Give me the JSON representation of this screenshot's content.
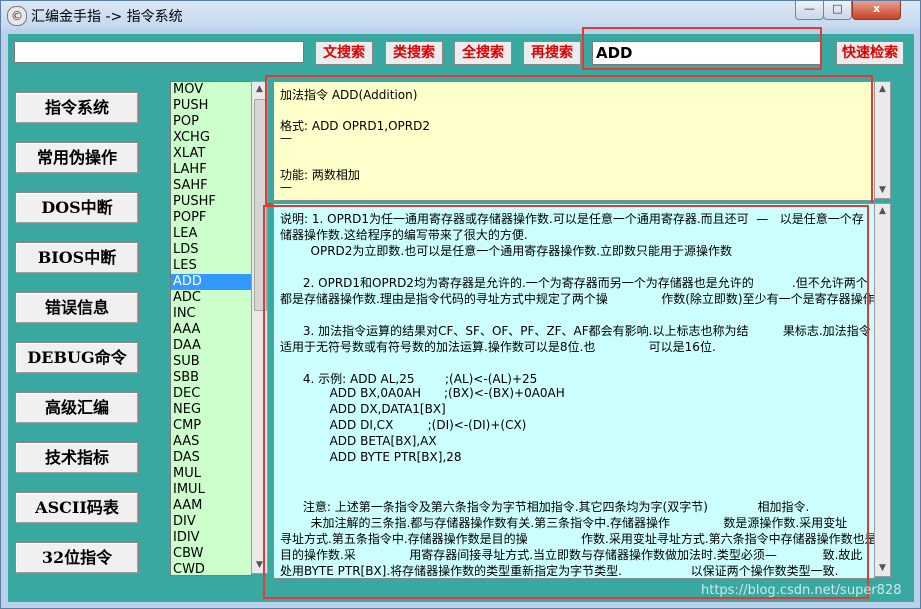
{
  "window": {
    "title": "汇编金手指 -> 指令系统",
    "icon": "app-logo-icon",
    "minimize_label": "—",
    "maximize_label": "□",
    "close_label": "x"
  },
  "toolbar": {
    "search_value": "",
    "buttons": [
      "文搜索",
      "类搜索",
      "全搜索",
      "再搜索"
    ],
    "command_value": "ADD",
    "quick_search_label": "快速检索"
  },
  "nav": {
    "items": [
      "指令系统",
      "常用伪操作",
      "DOS中断",
      "BIOS中断",
      "错误信息",
      "DEBUG命令",
      "高级汇编",
      "技术指标",
      "ASCII码表",
      "32位指令"
    ]
  },
  "instruction_list": {
    "items": [
      "MOV",
      "PUSH",
      "POP",
      "XCHG",
      "XLAT",
      "LAHF",
      "SAHF",
      "PUSHF",
      "POPF",
      "LEA",
      "LDS",
      "LES",
      "ADD",
      "ADC",
      "INC",
      "AAA",
      "DAA",
      "SUB",
      "SBB",
      "DEC",
      "NEG",
      "CMP",
      "AAS",
      "DAS",
      "MUL",
      "IMUL",
      "AAM",
      "DIV",
      "IDIV",
      "CBW",
      "CWD"
    ],
    "selected": "ADD"
  },
  "definition": {
    "title": "加法指令 ADD(Addition)",
    "format_line": "格式: ADD OPRD1,OPRD2",
    "format_underline": "—",
    "function_line": "功能: 两数相加",
    "function_underline": "—"
  },
  "description": {
    "lines": [
      "说明: 1. OPRD1为任一通用寄存器或存储器操作数.可以是任意一个通用寄存器.而且还可  —   以是任意一个存",
      "储器操作数.这给程序的编写带来了很大的方便.",
      "        OPRD2为立即数.也可以是任意一个通用寄存器操作数.立即数只能用于源操作数",
      "",
      "      2. OPRD1和OPRD2均为寄存器是允许的.一个为寄存器而另一个为存储器也是允许的          .但不允许两个",
      "都是存储器操作数.理由是指令代码的寻址方式中规定了两个操              作数(除立即数)至少有一个是寄存器操作数.",
      "",
      "      3. 加法指令运算的结果对CF、SF、OF、PF、ZF、AF都会有影响.以上标志也称为结         果标志.加法指令",
      "适用于无符号数或有符号数的加法运算.操作数可以是8位.也              可以是16位.",
      "",
      "      4. 示例: ADD AL,25        ;(AL)<-(AL)+25",
      "             ADD BX,0A0AH      ;(BX)<-(BX)+0A0AH",
      "             ADD DX,DATA1[BX]",
      "             ADD DI,CX         ;(DI)<-(DI)+(CX)",
      "             ADD BETA[BX],AX",
      "             ADD BYTE PTR[BX],28",
      "",
      "",
      "      注意: 上述第一条指令及第六条指令为字节相加指令.其它四条均为字(双字节)             相加指令.",
      "        未加注解的三条指.都与存储器操作数有关.第三条指令中.存储器操作              数是源操作数.采用变址",
      "寻址方式.第五条指令中.存储器操作数是目的操              作数.采用变址寻址方式.第六条指令中存储器操作数也是",
      "目的操作数.采              用寄存器间接寻址方式.当立即数与存储器操作数做加法时.类型必须—            致.故此",
      "处用BYTE PTR[BX].将存储器操作数的类型重新指定为字节类型.                  以保证两个操作数类型一致."
    ]
  },
  "watermark": "https://blog.csdn.net/super828"
}
